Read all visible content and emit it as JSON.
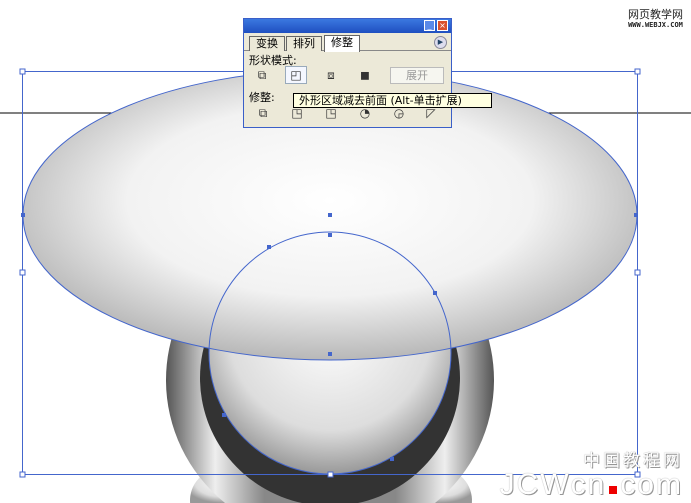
{
  "panel": {
    "tabs": [
      "变换",
      "排列",
      "修整"
    ],
    "active_tab": "修整",
    "shape_modes_label": "形状模式:",
    "expand_label": "展开",
    "pathfinder_label": "修整:",
    "tooltip": "外形区域减去前面 (Alt-单击扩展)"
  },
  "watermark_top": {
    "title": "网页教学网",
    "url": "WWW.WEBJX.COM"
  },
  "watermark_bottom": {
    "cn": "中国教程网",
    "left": "JCWcn",
    "right": "com"
  }
}
